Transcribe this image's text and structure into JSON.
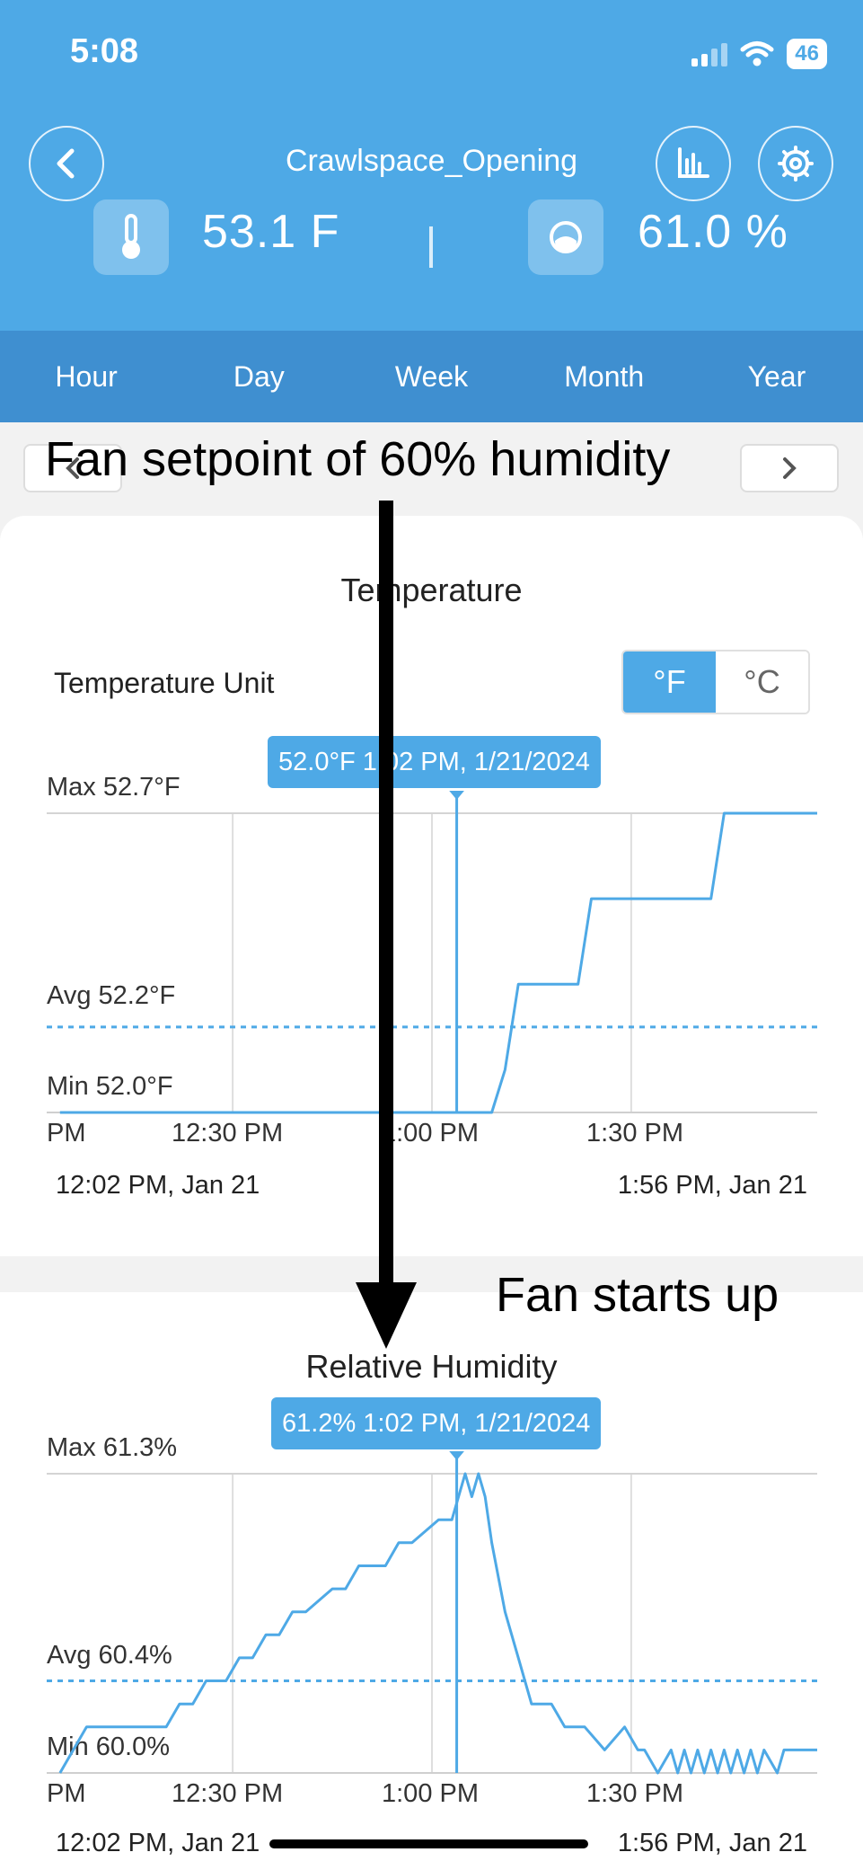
{
  "status_bar": {
    "time": "5:08",
    "battery": "46"
  },
  "device": {
    "title": "Crawlspace_Opening"
  },
  "readings": {
    "temperature": "53.1  F",
    "humidity": "61.0  %"
  },
  "tabs": [
    "Hour",
    "Day",
    "Week",
    "Month",
    "Year"
  ],
  "annotations": {
    "setpoint": "Fan setpoint of 60% humidity",
    "fan_start": "Fan starts up"
  },
  "colors": {
    "accent": "#4ea9e6",
    "tab_bar": "#3f8fd0",
    "line": "#4ea9e6",
    "annotation": "#000000"
  },
  "icons": [
    "back-icon",
    "chart-icon",
    "gear-icon",
    "thermometer-icon",
    "humidity-icon",
    "chevron-left-icon",
    "chevron-right-icon"
  ],
  "temperature_unit": {
    "label": "Temperature Unit",
    "options": [
      "°F",
      "°C"
    ],
    "selected": "°F"
  },
  "chart_data": [
    {
      "type": "line",
      "title": "Temperature",
      "x_range": [
        "12:02 PM",
        "1:56 PM"
      ],
      "x_ticks": [
        "PM",
        "12:30 PM",
        "1:00 PM",
        "1:30 PM"
      ],
      "range_start": "12:02 PM,  Jan 21",
      "range_end": "1:56 PM,  Jan 21",
      "max_label": "Max 52.7°F",
      "avg_label": "Avg 52.2°F",
      "min_label": "Min 52.0°F",
      "tooltip": "52.0°F  1:02 PM,  1/21/2024",
      "cursor_x": 62,
      "ylim": [
        52.0,
        52.7
      ],
      "avg": 52.2,
      "x": [
        2,
        62,
        65,
        67,
        69,
        71,
        80,
        82,
        100,
        102,
        111,
        116
      ],
      "y": [
        52.0,
        52.0,
        52.0,
        52.0,
        52.1,
        52.3,
        52.3,
        52.5,
        52.5,
        52.7,
        52.7,
        52.7
      ]
    },
    {
      "type": "line",
      "title": "Relative Humidity",
      "x_range": [
        "12:02 PM",
        "1:56 PM"
      ],
      "x_ticks": [
        "PM",
        "12:30 PM",
        "1:00 PM",
        "1:30 PM"
      ],
      "range_start": "12:02 PM,  Jan 21",
      "range_end": "1:56 PM,  Jan 21",
      "max_label": "Max 61.3%",
      "avg_label": "Avg 60.4%",
      "min_label": "Min 60.0%",
      "tooltip": "61.2%  1:02 PM,  1/21/2024",
      "cursor_x": 62,
      "ylim": [
        60.0,
        61.3
      ],
      "avg": 60.4,
      "x": [
        2,
        4,
        6,
        18,
        20,
        22,
        24,
        27,
        29,
        31,
        33,
        35,
        37,
        39,
        43,
        45,
        47,
        51,
        53,
        55,
        59,
        61,
        62,
        63,
        64,
        65,
        66,
        67,
        69,
        71,
        73,
        76,
        78,
        81,
        84,
        87,
        89,
        90,
        92,
        94,
        95,
        96,
        97,
        98,
        99,
        100,
        101,
        102,
        103,
        104,
        105,
        106,
        107,
        108,
        110,
        111,
        116
      ],
      "y": [
        60.0,
        60.1,
        60.2,
        60.2,
        60.3,
        60.3,
        60.4,
        60.4,
        60.5,
        60.5,
        60.6,
        60.6,
        60.7,
        60.7,
        60.8,
        60.8,
        60.9,
        60.9,
        61.0,
        61.0,
        61.1,
        61.1,
        61.2,
        61.3,
        61.2,
        61.3,
        61.2,
        61.0,
        60.7,
        60.5,
        60.3,
        60.3,
        60.2,
        60.2,
        60.1,
        60.2,
        60.1,
        60.1,
        60.0,
        60.1,
        60.0,
        60.1,
        60.0,
        60.1,
        60.0,
        60.1,
        60.0,
        60.1,
        60.0,
        60.1,
        60.0,
        60.1,
        60.0,
        60.1,
        60.0,
        60.1,
        60.1
      ]
    }
  ]
}
